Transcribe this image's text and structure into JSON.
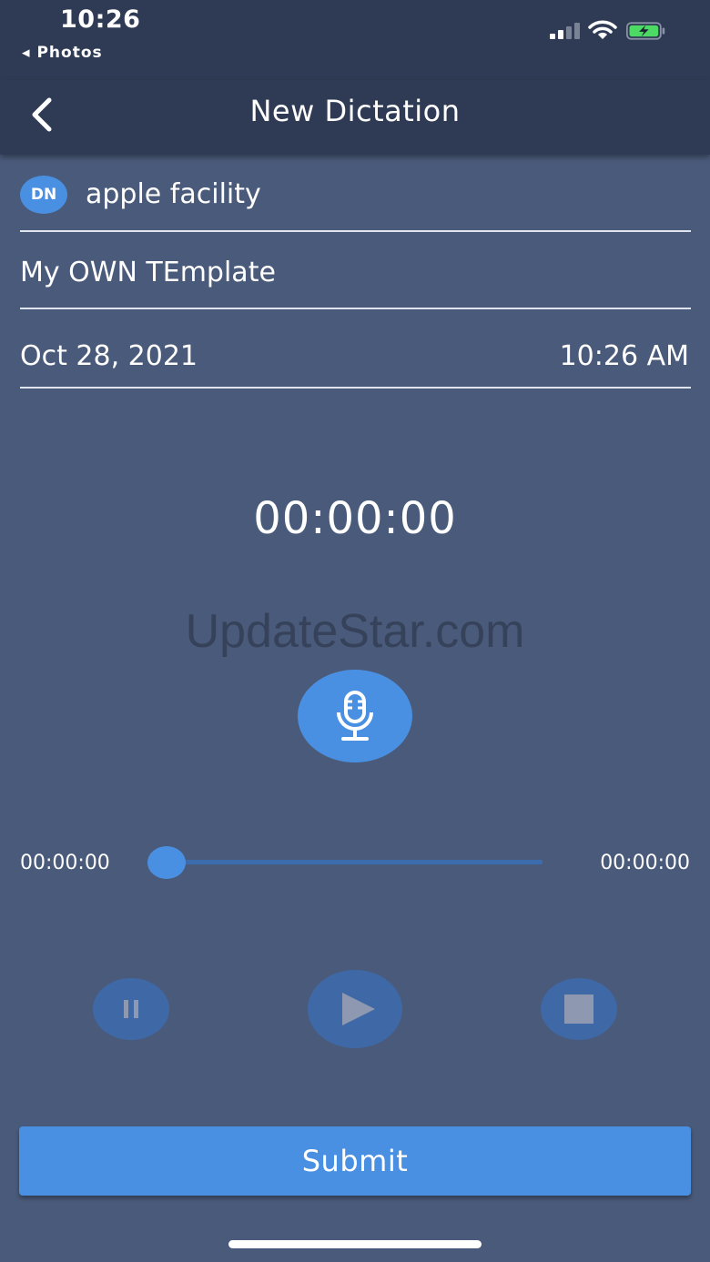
{
  "status_bar": {
    "time": "10:26",
    "back_app": "◂ Photos",
    "signal_icon": "cellular-signal-icon",
    "wifi_icon": "wifi-icon",
    "battery_icon": "battery-charging-icon",
    "battery_color": "#4cd964"
  },
  "nav": {
    "title": "New Dictation",
    "back_icon": "chevron-left-icon"
  },
  "form": {
    "facility_badge": "DN",
    "facility": "apple facility",
    "template": "My OWN TEmplate",
    "date": "Oct 28, 2021",
    "time": "10:26 AM"
  },
  "recorder": {
    "timer": "00:00:00",
    "mic_icon": "microphone-icon"
  },
  "watermark": "UpdateStar.com",
  "playback": {
    "elapsed": "00:00:00",
    "duration": "00:00:00",
    "progress": 0,
    "pause_icon": "pause-icon",
    "play_icon": "play-icon",
    "stop_icon": "stop-icon"
  },
  "submit_label": "Submit",
  "colors": {
    "background": "#4a5a7a",
    "header": "#2f3b55",
    "accent": "#4a90e2",
    "control": "#3d6cae"
  }
}
